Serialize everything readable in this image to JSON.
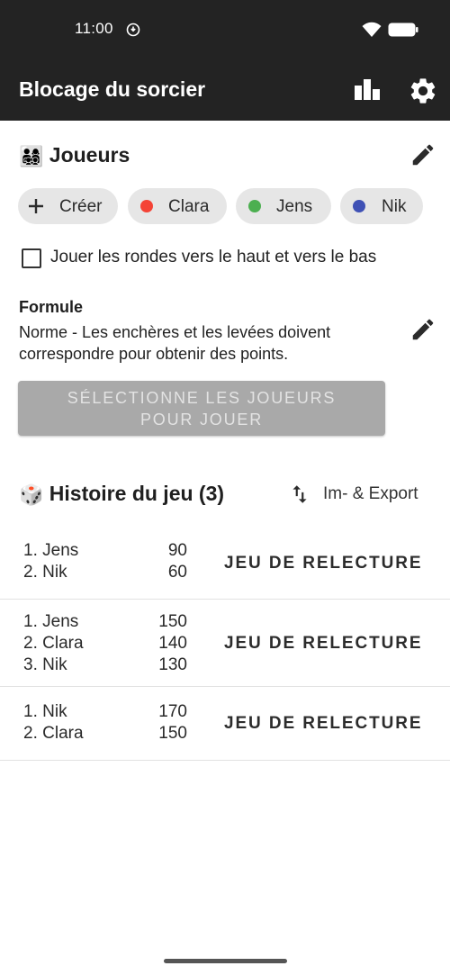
{
  "status_bar": {
    "time": "11:00"
  },
  "app_bar": {
    "title": "Blocage du sorcier",
    "chart_icon": "bar-chart-icon",
    "settings_icon": "gear-icon"
  },
  "players_section": {
    "emoji": "👨‍👩‍👧‍👦",
    "title": "Joueurs",
    "create_label": "Créer",
    "players": [
      {
        "name": "Clara",
        "color": "#f44336"
      },
      {
        "name": "Jens",
        "color": "#4caf50"
      },
      {
        "name": "Nik",
        "color": "#3f51b5"
      }
    ],
    "up_down_label": "Jouer les rondes vers le haut et vers le bas",
    "up_down_checked": false
  },
  "formula": {
    "heading": "Formule",
    "description": "Norme - Les enchères et les levées doivent correspondre pour obtenir des points."
  },
  "select_button": {
    "line1": "SÉLECTIONNE LES JOUEURS",
    "line2": "POUR JOUER"
  },
  "history": {
    "emoji": "🎲",
    "title": "Histoire du jeu (3)",
    "import_export_label": "Im- & Export",
    "games": [
      {
        "results": [
          {
            "rank_name": "1. Jens",
            "score": "90"
          },
          {
            "rank_name": "2. Nik",
            "score": "60"
          }
        ],
        "replay_label": "JEU DE RELECTURE"
      },
      {
        "results": [
          {
            "rank_name": "1. Jens",
            "score": "150"
          },
          {
            "rank_name": "2. Clara",
            "score": "140"
          },
          {
            "rank_name": "3. Nik",
            "score": "130"
          }
        ],
        "replay_label": "JEU DE RELECTURE"
      },
      {
        "results": [
          {
            "rank_name": "1. Nik",
            "score": "170"
          },
          {
            "rank_name": "2. Clara",
            "score": "150"
          }
        ],
        "replay_label": "JEU DE RELECTURE"
      }
    ]
  }
}
